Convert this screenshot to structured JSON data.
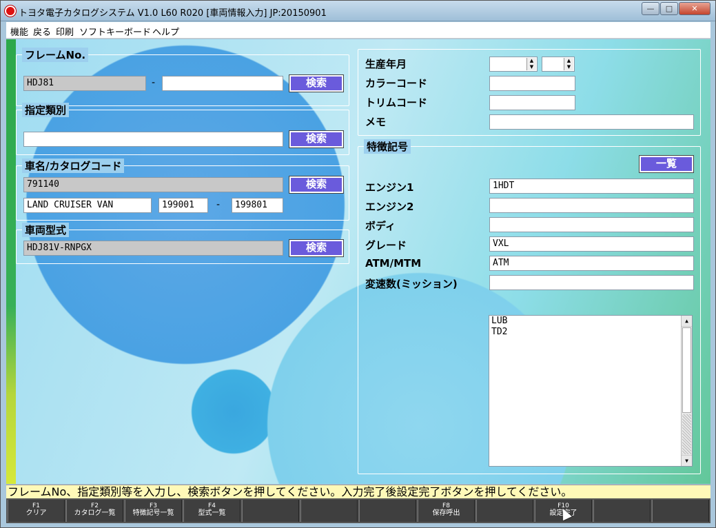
{
  "window": {
    "title": "トヨタ電子カタログシステム V1.0 L60 R020 [車両情報入力] JP:20150901",
    "min": "—",
    "max": "□",
    "close": "✕"
  },
  "menu": [
    "機能",
    "戻る",
    "印刷",
    "ソフトキーボード",
    "ヘルプ"
  ],
  "frame_no": {
    "title": "フレームNo.",
    "value1": "HDJ81",
    "value2": "",
    "search": "検索"
  },
  "shitei": {
    "title": "指定類別",
    "value": "",
    "search": "検索"
  },
  "car_name": {
    "title": "車名/カタログコード",
    "code": "791140",
    "search": "検索",
    "name": "LAND CRUISER VAN",
    "from": "199001",
    "to": "199801",
    "dash": "-"
  },
  "model": {
    "title": "車両型式",
    "value": "HDJ81V-RNPGX",
    "search": "検索"
  },
  "right_top": {
    "production_label": "生産年月",
    "color_label": "カラーコード",
    "trim_label": "トリムコード",
    "memo_label": "メモ",
    "color": "",
    "trim": "",
    "memo": ""
  },
  "features": {
    "title": "特徴記号",
    "list_button": "一覧",
    "engine1_label": "エンジン1",
    "engine1": "1HDT",
    "engine2_label": "エンジン2",
    "engine2": "",
    "body_label": "ボディ",
    "body": "",
    "grade_label": "グレード",
    "grade": "VXL",
    "atm_label": "ATM/MTM",
    "atm": "ATM",
    "gears_label": "変速数(ミッション)",
    "gears": "",
    "list": [
      "LUB",
      "TD2"
    ]
  },
  "status": "フレームNo、指定類別等を入力し、検索ボタンを押してください。入力完了後設定完了ボタンを押してください。",
  "fkeys": [
    {
      "key": "F1",
      "label": "クリア"
    },
    {
      "key": "F2",
      "label": "カタログ一覧"
    },
    {
      "key": "F3",
      "label": "特徴記号一覧"
    },
    {
      "key": "F4",
      "label": "型式一覧"
    },
    {
      "key": "",
      "label": ""
    },
    {
      "key": "",
      "label": ""
    },
    {
      "key": "",
      "label": ""
    },
    {
      "key": "F8",
      "label": "保存呼出"
    },
    {
      "key": "",
      "label": ""
    },
    {
      "key": "F10",
      "label": "設定完了"
    },
    {
      "key": "",
      "label": ""
    },
    {
      "key": "",
      "label": ""
    }
  ]
}
